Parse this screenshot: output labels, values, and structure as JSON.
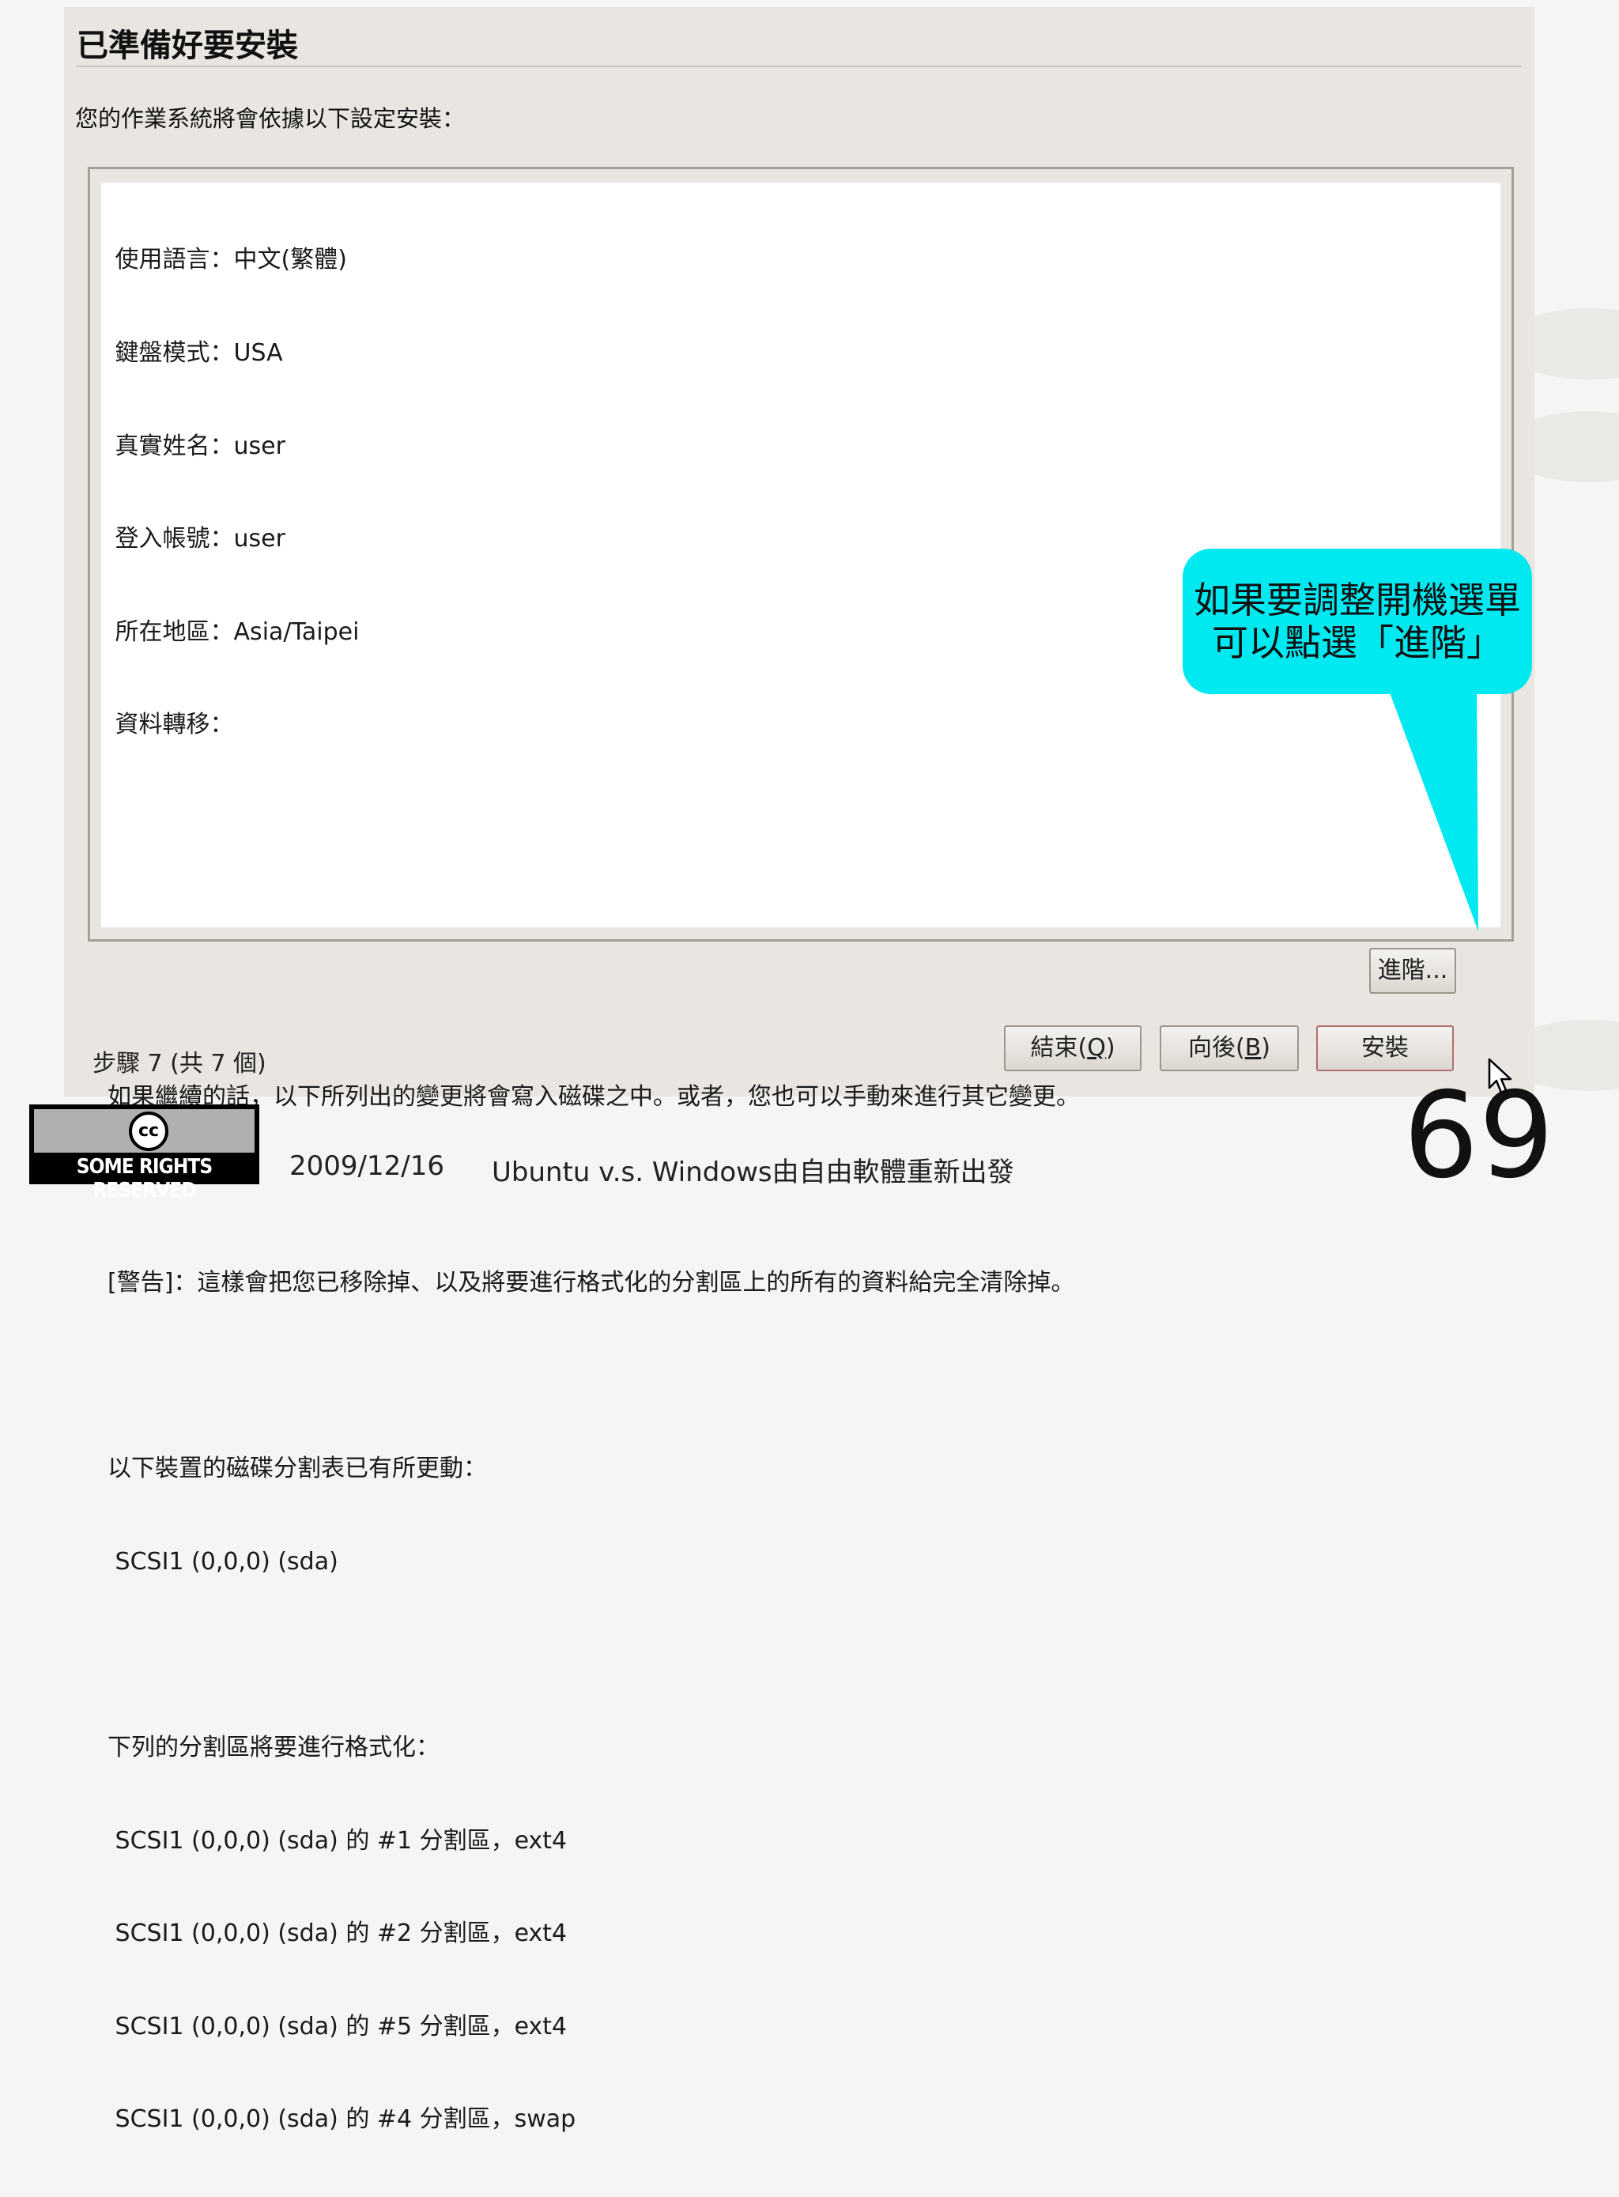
{
  "window": {
    "title": "已準備好要安裝",
    "intro": "您的作業系統將會依據以下設定安裝："
  },
  "summary": {
    "lines": [
      " 使用語言：中文(繁體)",
      " 鍵盤模式：USA",
      " 真實姓名：user",
      " 登入帳號：user",
      " 所在地區：Asia/Taipei",
      " 資料轉移：",
      "",
      "",
      "",
      "如果繼續的話，以下所列出的變更將會寫入磁碟之中。或者，您也可以手動來進行其它變更。",
      "",
      "[警告]：這樣會把您已移除掉、以及將要進行格式化的分割區上的所有的資料給完全清除掉。",
      "",
      "以下裝置的磁碟分割表已有所更動：",
      " SCSI1 (0,0,0) (sda)",
      "",
      "下列的分割區將要進行格式化：",
      " SCSI1 (0,0,0) (sda) 的 #1 分割區，ext4",
      " SCSI1 (0,0,0) (sda) 的 #2 分割區，ext4",
      " SCSI1 (0,0,0) (sda) 的 #5 分割區，ext4",
      " SCSI1 (0,0,0) (sda) 的 #4 分割區，swap"
    ]
  },
  "callout": {
    "line1": "如果要調整開機選單",
    "line2": "可以點選「進階」"
  },
  "buttons": {
    "advanced": "進階...",
    "quit": "結束(",
    "quit_key": "Q",
    "back": "向後(",
    "back_key": "B",
    "key_close": ")",
    "install": "安裝"
  },
  "step": "步驟 7 (共 7 個)",
  "footer": {
    "date": "2009/12/16",
    "title": "Ubuntu v.s. Windows由自由軟體重新出發",
    "page_number": "69",
    "cc_logo": "cc",
    "cc_text": "SOME RIGHTS RESERVED"
  },
  "colors": {
    "callout": "#00e8f0",
    "window_bg": "#e9e5e0"
  }
}
